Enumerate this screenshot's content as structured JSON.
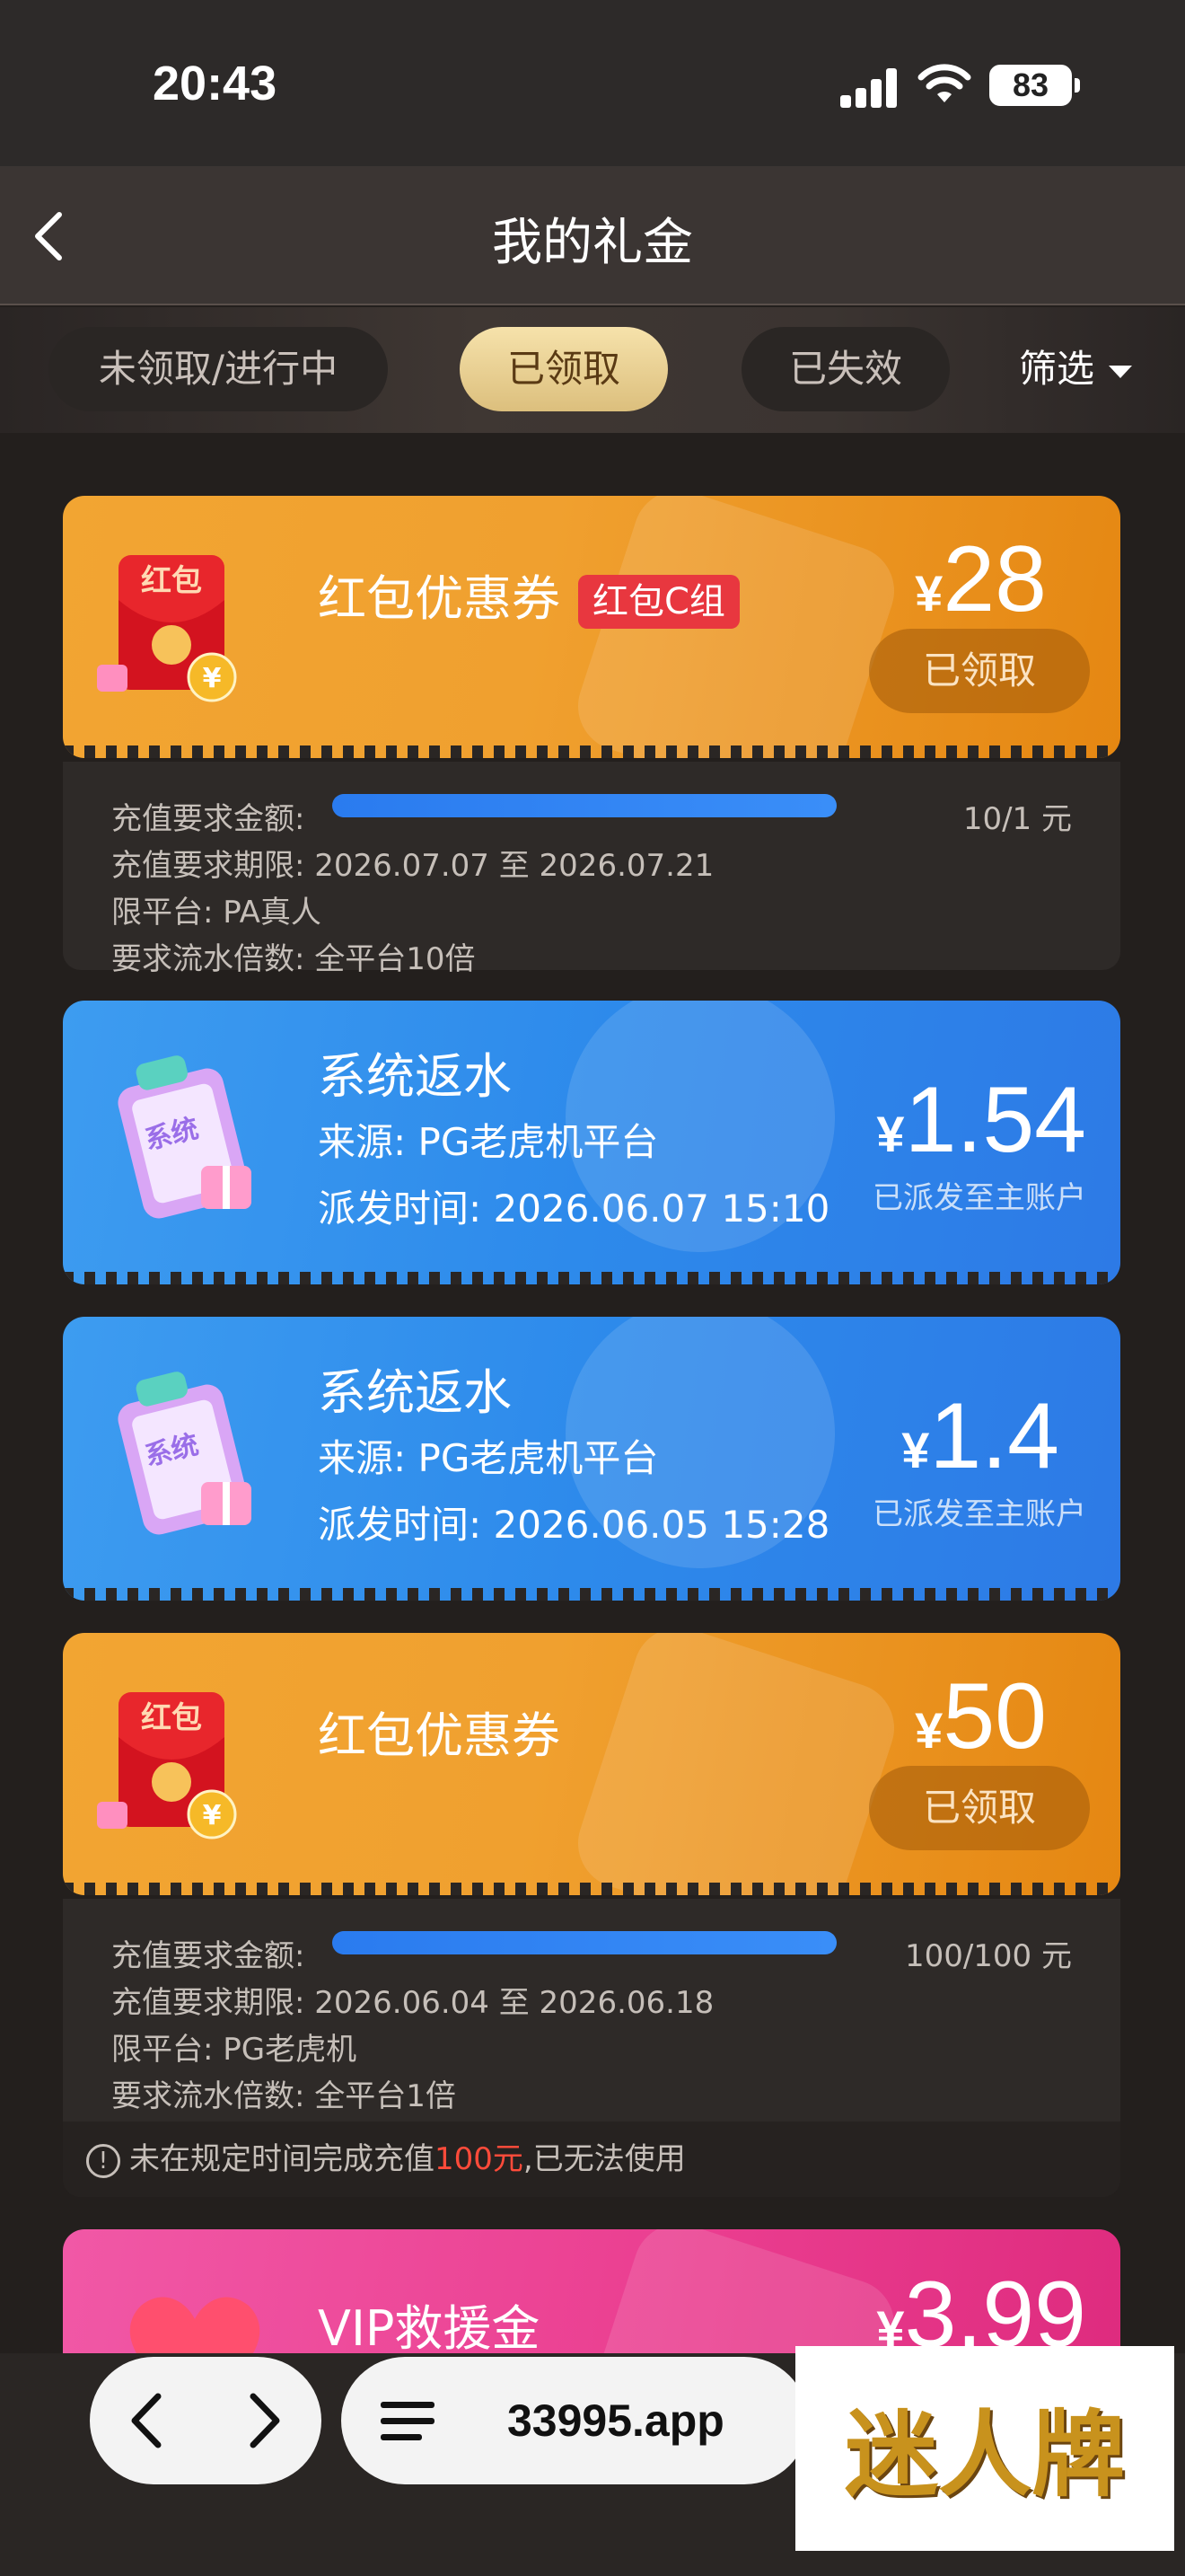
{
  "status_bar": {
    "time": "20:43",
    "battery": "83"
  },
  "header": {
    "title": "我的礼金"
  },
  "tabs": [
    {
      "label": "未领取/进行中",
      "active": false
    },
    {
      "label": "已领取",
      "active": true
    },
    {
      "label": "已失效",
      "active": false
    }
  ],
  "filter": {
    "label": "筛选"
  },
  "cards": [
    {
      "type": "红包优惠券",
      "icon": "red-envelope-icon",
      "title": "红包优惠券",
      "tag": "红包C组",
      "currency": "¥",
      "amount": "28",
      "button": "已领取",
      "detail": {
        "amount_label": "充值要求金额:",
        "progress": 1.0,
        "ratio": "10/1 元",
        "period": "充值要求期限: 2026.07.07 至 2026.07.21",
        "platform": "限平台: PA真人",
        "turnover": "要求流水倍数: 全平台10倍"
      }
    },
    {
      "type": "系统返水",
      "icon": "clipboard-gift-icon",
      "title": "系统返水",
      "source": "来源: PG老虎机平台",
      "time": "派发时间: 2026.06.07 15:10",
      "currency": "¥",
      "amount": "1.54",
      "status": "已派发至主账户"
    },
    {
      "type": "系统返水",
      "icon": "clipboard-gift-icon",
      "title": "系统返水",
      "source": "来源: PG老虎机平台",
      "time": "派发时间: 2026.06.05 15:28",
      "currency": "¥",
      "amount": "1.4",
      "status": "已派发至主账户"
    },
    {
      "type": "红包优惠券",
      "icon": "red-envelope-icon",
      "title": "红包优惠券",
      "currency": "¥",
      "amount": "50",
      "button": "已领取",
      "detail": {
        "amount_label": "充值要求金额:",
        "progress": 1.0,
        "ratio": "100/100 元",
        "period": "充值要求期限: 2026.06.04 至 2026.06.18",
        "platform": "限平台: PG老虎机",
        "turnover": "要求流水倍数: 全平台1倍",
        "warning_prefix": "未在规定时间完成充值",
        "warning_highlight": "100元",
        "warning_suffix": ",已无法使用"
      }
    },
    {
      "type": "VIP救援金",
      "icon": "heart-rescue-icon",
      "title": "VIP救援金",
      "currency": "¥",
      "amount": "3.99"
    }
  ],
  "browser_bar": {
    "url": "33995.app"
  },
  "watermark": "迷人牌",
  "colors": {
    "orange": "#f0a02f",
    "blue": "#2d8aeb",
    "pink": "#ea3d8f",
    "gold_tab": "#f6e2ab",
    "progress": "#2a7bef",
    "warning": "#ff4b3a"
  }
}
